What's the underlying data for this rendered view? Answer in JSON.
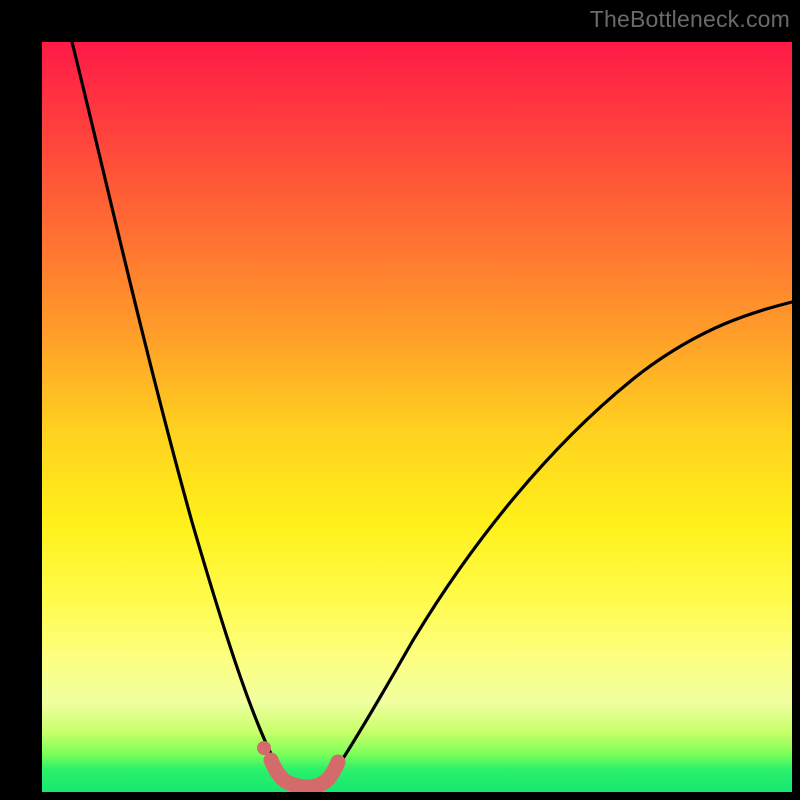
{
  "watermark": "TheBottleneck.com",
  "chart_data": {
    "type": "line",
    "title": "",
    "xlabel": "",
    "ylabel": "",
    "xlim": [
      0,
      100
    ],
    "ylim": [
      0,
      100
    ],
    "series": [
      {
        "name": "left-curve",
        "x": [
          4,
          6,
          8,
          10,
          12,
          14,
          16,
          18,
          20,
          22,
          24,
          26,
          28,
          30,
          31,
          32
        ],
        "y": [
          100,
          90,
          80,
          70,
          60,
          51,
          43,
          36,
          29.5,
          23.5,
          18,
          13,
          8.5,
          4.5,
          2.7,
          1.8
        ]
      },
      {
        "name": "right-curve",
        "x": [
          38,
          40,
          43,
          46,
          50,
          55,
          60,
          66,
          72,
          78,
          84,
          90,
          96,
          100
        ],
        "y": [
          2.0,
          4.0,
          8.5,
          13.5,
          20,
          27,
          33.5,
          40,
          46,
          51,
          55.5,
          59.5,
          63,
          65
        ]
      },
      {
        "name": "pink-overlay",
        "x": [
          30.5,
          31.5,
          32.5,
          33.5,
          34.5,
          35.5,
          36.5,
          37.5,
          38.5
        ],
        "y": [
          4.2,
          2.6,
          1.7,
          1.3,
          1.2,
          1.3,
          1.7,
          2.6,
          4.2
        ]
      },
      {
        "name": "pink-dot",
        "x": [
          29.5
        ],
        "y": [
          6.0
        ]
      }
    ],
    "colors": {
      "curve": "#000000",
      "overlay": "#d46a6a",
      "background_top": "#ff1a47",
      "background_bottom": "#17e870"
    }
  }
}
